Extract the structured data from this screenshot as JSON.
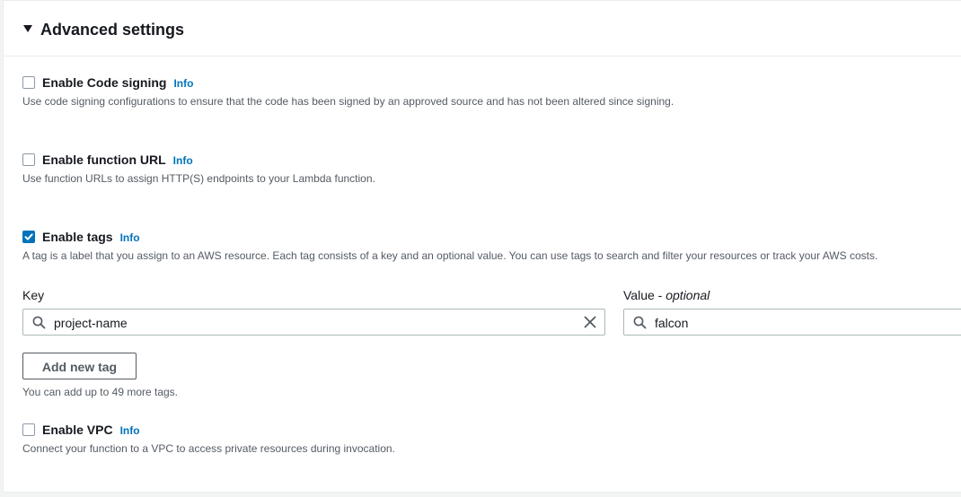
{
  "section": {
    "title": "Advanced settings"
  },
  "options": {
    "code_signing": {
      "label": "Enable Code signing",
      "info": "Info",
      "description": "Use code signing configurations to ensure that the code has been signed by an approved source and has not been altered since signing.",
      "checked": false
    },
    "function_url": {
      "label": "Enable function URL",
      "info": "Info",
      "description": "Use function URLs to assign HTTP(S) endpoints to your Lambda function.",
      "checked": false
    },
    "tags": {
      "label": "Enable tags",
      "info": "Info",
      "description": "A tag is a label that you assign to an AWS resource. Each tag consists of a key and an optional value. You can use tags to search and filter your resources or track your AWS costs.",
      "checked": true
    },
    "vpc": {
      "label": "Enable VPC",
      "info": "Info",
      "description": "Connect your function to a VPC to access private resources during invocation.",
      "checked": false
    }
  },
  "tags": {
    "key_label": "Key",
    "value_label": "Value",
    "value_label_optional": "optional",
    "value_label_sep": " - ",
    "rows": [
      {
        "key": "project-name",
        "value": "falcon"
      }
    ],
    "add_button": "Add new tag",
    "hint": "You can add up to 49 more tags."
  },
  "colors": {
    "accent": "#0073bb",
    "text": "#16191f",
    "secondary_text": "#545b64",
    "border": "#aab7b8"
  }
}
